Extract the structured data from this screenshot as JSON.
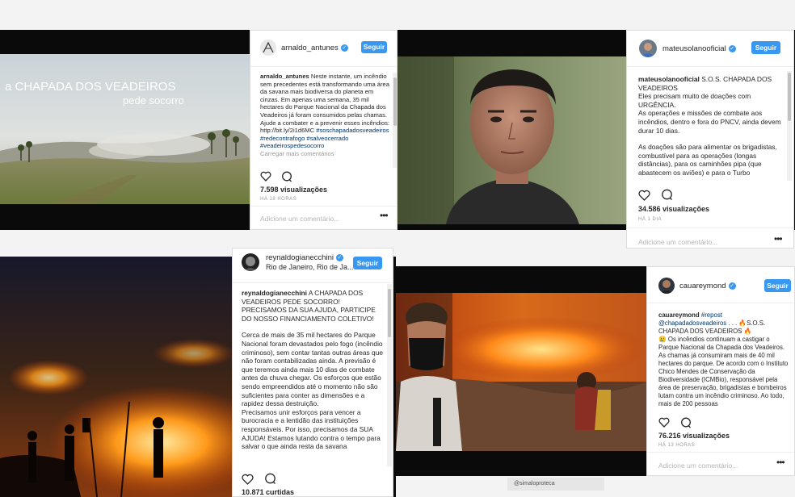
{
  "posts": [
    {
      "username": "arnaldo_antunes",
      "follow_label": "Seguir",
      "video_title_line1": "a CHAPADA DOS VEADEIROS",
      "video_title_line2": "pede socorro",
      "caption_user": "arnaldo_antunes",
      "caption_text": "Neste instante, um incêndio sem precedentes está transformando uma área da savana mais biodiversa do planeta em cinzas. Em apenas uma semana, 35 mil hectares do Parque Nacional da Chapada dos Veadeiros já foram consumidos pelas chamas. Ajude a combater e a prevenir esses incêndios: http://bit.ly/2i1d6MC",
      "hashtags": "#soschapadadosveadeiros #redecontrafogo #salveocerrado #veadeirospedesocorro",
      "more_comments": "Carregar mais comentários",
      "views": "7.598 visualizações",
      "time": "HÁ 18 HORAS",
      "comment_placeholder": "Adicione um comentário..."
    },
    {
      "username": "mateusolanooficial",
      "follow_label": "Seguir",
      "caption_user": "mateusolanooficial",
      "caption_lines": [
        "S.O.S. CHAPADA DOS VEADEIROS",
        "Eles precisam muito de doações com URGÊNCIA.",
        "As operações e missões de combate aos incêndios, dentro e fora do PNCV, ainda devem durar 10 dias.",
        "As doações são para alimentar os brigadistas, combustível para as operações (longas distâncias), para os caminhões pipa (que abastecem os aviões) e para o Turbo"
      ],
      "views": "34.586 visualizações",
      "time": "HÁ 1 DIA",
      "comment_placeholder": "Adicione um comentário..."
    },
    {
      "username": "reynaldogianecchini",
      "follow_label": "Seguir",
      "location": "Rio de Janeiro, Rio de Ja...",
      "caption_user": "reynaldogianecchini",
      "caption_lines": [
        "A CHAPADA DOS VEADEIROS PEDE SOCORRO! PRECISAMOS DA SUA AJUDA, PARTICIPE DO NOSSO FINANCIAMENTO COLETIVO!",
        "Cerca de mais de 35 mil hectares do Parque Nacional foram devastados pelo fogo (incêndio criminoso), sem contar tantas outras áreas que não foram contabilizadas ainda. A previsão é que teremos ainda mais 10 dias de combate antes da chuva chegar. Os esforços que estão sendo empreendidos até o momento não são suficientes para conter as dimensões e a rapidez dessa destruição.",
        "Precisamos unir esforços para vencer a burocracia e a lentidão das instituições responsáveis. Por isso, precisamos da SUA AJUDA! Estamos lutando contra o tempo para salvar o que ainda resta da savana"
      ],
      "likes": "10.871 curtidas"
    },
    {
      "username": "cauareymond",
      "follow_label": "Seguir",
      "caption_user": "cauareymond",
      "repost": "#repost",
      "mention": "@chapadadosveadeiros",
      "caption_line1": " . . . 🔥S.O.S. CHAPADA DOS VEADEIROS 🔥",
      "caption_body": "😢 Os incêndios continuam a castigar o Parque Nacional da Chapada dos Veadeiros. As chamas já consumiram mais de 40 mil hectares do parque. De acordo com o Instituto Chico Mendes de Conservação da Biodiversidade (ICMBio), responsável pela área de preservação, brigadistas e bombeiros lutam contra um incêndio criminoso. Ao todo, mais de 200 pessoas",
      "views": "76.216 visualizações",
      "time": "HÁ 13 HORAS",
      "comment_placeholder": "Adicione um comentário..."
    }
  ],
  "bottom_fragment": "@simaloproteca"
}
